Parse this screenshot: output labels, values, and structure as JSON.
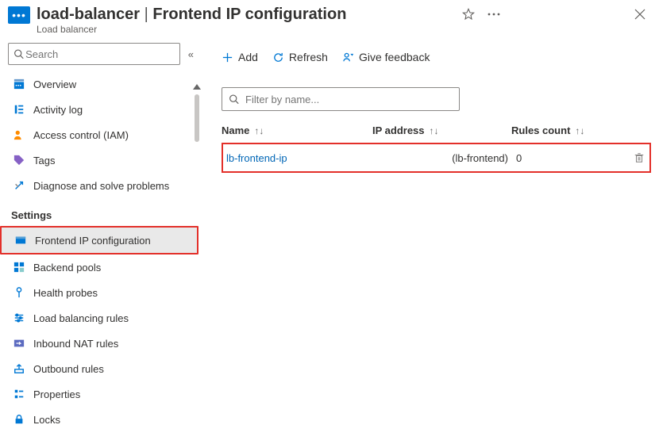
{
  "header": {
    "resource_name": "load-balancer",
    "page_title": "Frontend IP configuration",
    "subtitle": "Load balancer"
  },
  "sidebar": {
    "search_placeholder": "Search",
    "items_top": [
      {
        "label": "Overview",
        "icon": "overview-icon"
      },
      {
        "label": "Activity log",
        "icon": "activity-log-icon"
      },
      {
        "label": "Access control (IAM)",
        "icon": "access-control-icon"
      },
      {
        "label": "Tags",
        "icon": "tags-icon"
      },
      {
        "label": "Diagnose and solve problems",
        "icon": "diagnose-icon"
      }
    ],
    "section_label": "Settings",
    "items_settings": [
      {
        "label": "Frontend IP configuration",
        "icon": "frontend-ip-icon",
        "selected": true
      },
      {
        "label": "Backend pools",
        "icon": "backend-pools-icon"
      },
      {
        "label": "Health probes",
        "icon": "health-probes-icon"
      },
      {
        "label": "Load balancing rules",
        "icon": "lb-rules-icon"
      },
      {
        "label": "Inbound NAT rules",
        "icon": "inbound-nat-icon"
      },
      {
        "label": "Outbound rules",
        "icon": "outbound-rules-icon"
      },
      {
        "label": "Properties",
        "icon": "properties-icon"
      },
      {
        "label": "Locks",
        "icon": "locks-icon"
      }
    ]
  },
  "toolbar": {
    "add_label": "Add",
    "refresh_label": "Refresh",
    "feedback_label": "Give feedback"
  },
  "filter": {
    "placeholder": "Filter by name..."
  },
  "table": {
    "columns": {
      "name": "Name",
      "ip": "IP address",
      "rules": "Rules count"
    },
    "rows": [
      {
        "name": "lb-frontend-ip",
        "ip": "(lb-frontend)",
        "rules": "0"
      }
    ]
  }
}
